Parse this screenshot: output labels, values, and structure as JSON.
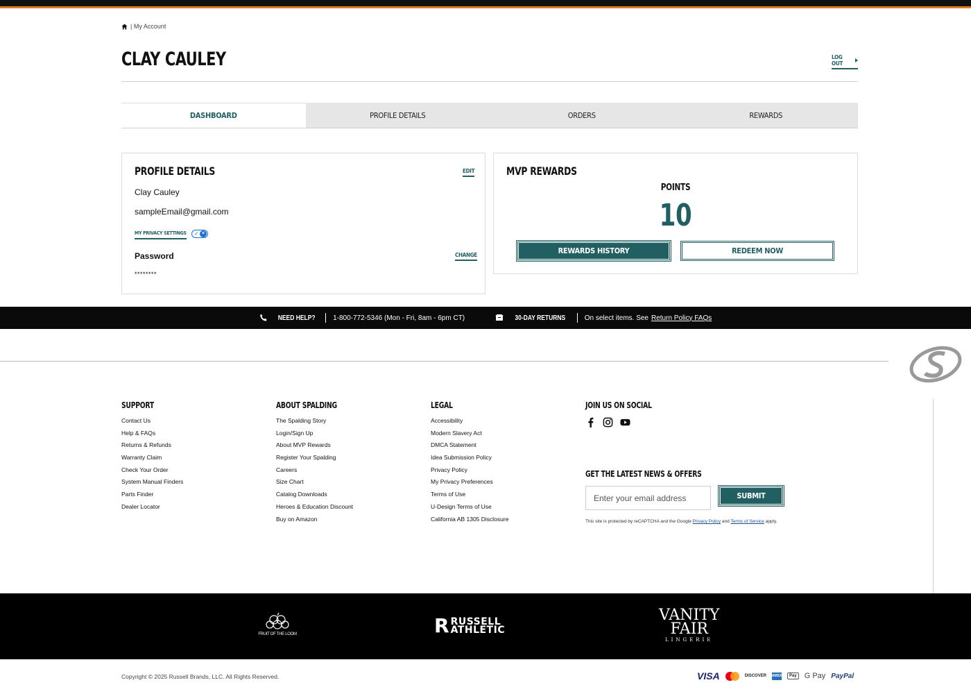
{
  "breadcrumb": {
    "current": "| My Account"
  },
  "header": {
    "title": "CLAY CAULEY",
    "logout_label": "LOG OUT"
  },
  "tabs": [
    {
      "label": "DASHBOARD",
      "active": true
    },
    {
      "label": "PROFILE DETAILS",
      "active": false
    },
    {
      "label": "ORDERS",
      "active": false
    },
    {
      "label": "REWARDS",
      "active": false
    }
  ],
  "profile": {
    "title": "PROFILE DETAILS",
    "edit_label": "EDIT",
    "name": "Clay Cauley",
    "email": "sampleEmail@gmail.com",
    "privacy_label": "MY PRIVACY SETTINGS",
    "password_label": "Password",
    "password_change_label": "CHANGE",
    "password_value": "********"
  },
  "rewards": {
    "title": "MVP REWARDS",
    "points_label": "POINTS",
    "points_value": "10",
    "history_button": "REWARDS HISTORY",
    "redeem_button": "REDEEM NOW"
  },
  "helpbar": {
    "need_help": "NEED HELP?",
    "phone": "1-800-772-5346 (Mon - Fri, 8am - 6pm CT)",
    "returns": "30-DAY RETURNS",
    "returns_text": "On select items. See",
    "returns_link": "Return Policy FAQs"
  },
  "footer": {
    "support": {
      "title": "SUPPORT",
      "items": [
        "Contact Us",
        "Help & FAQs",
        "Returns & Refunds",
        "Warranty Claim",
        "Check Your Order",
        "System Manual Finders",
        "Parts Finder",
        "Dealer Locator"
      ]
    },
    "about": {
      "title": "ABOUT SPALDING",
      "items": [
        "The Spalding Story",
        "Login/Sign Up",
        "About MVP Rewards",
        "Register Your Spalding",
        "Careers",
        "Size Chart",
        "Catalog Downloads",
        "Heroes & Education Discount",
        "Buy on Amazon"
      ]
    },
    "legal": {
      "title": "LEGAL",
      "items": [
        "Accessibility",
        "Modern Slavery Act",
        "DMCA Statement",
        "Idea Submission Policy",
        "Privacy Policy",
        "My Privacy Preferences",
        "Terms of Use",
        "U-Design Terms of Use",
        "California AB 1305 Disclosure"
      ]
    },
    "social": {
      "title": "JOIN US ON SOCIAL",
      "icons": [
        "facebook-icon",
        "instagram-icon",
        "youtube-icon"
      ]
    },
    "newsletter": {
      "title": "GET THE LATEST NEWS & OFFERS",
      "placeholder": "Enter your email address",
      "submit": "SUBMIT",
      "recaptcha_pre": "This site is protected by reCAPTCHA and the Google",
      "recaptcha_privacy": "Privacy Policy",
      "recaptcha_and": "and",
      "recaptcha_terms": "Terms of Service",
      "recaptcha_post": "apply."
    }
  },
  "brands": {
    "fotl": "FRUIT OF THE LOOM",
    "russell_top": "RUSSELL",
    "russell_bottom": "ATHLETIC",
    "vf_top": "VANITY",
    "vf_bottom": "FAIR",
    "vf_sub": "LINGERIE"
  },
  "copyright": "Copyright © 2025 Russell Brands, LLC. All Rights Reserved.",
  "payments": {
    "visa": "VISA",
    "discover": "DISCOVER",
    "amex": "AMEX",
    "apple": "Pay",
    "gpay": "G Pay",
    "paypal": "PayPal"
  },
  "colors": {
    "accent": "#215f63",
    "top_stripe": "#e37c1e",
    "dark": "#0a0a0a"
  }
}
